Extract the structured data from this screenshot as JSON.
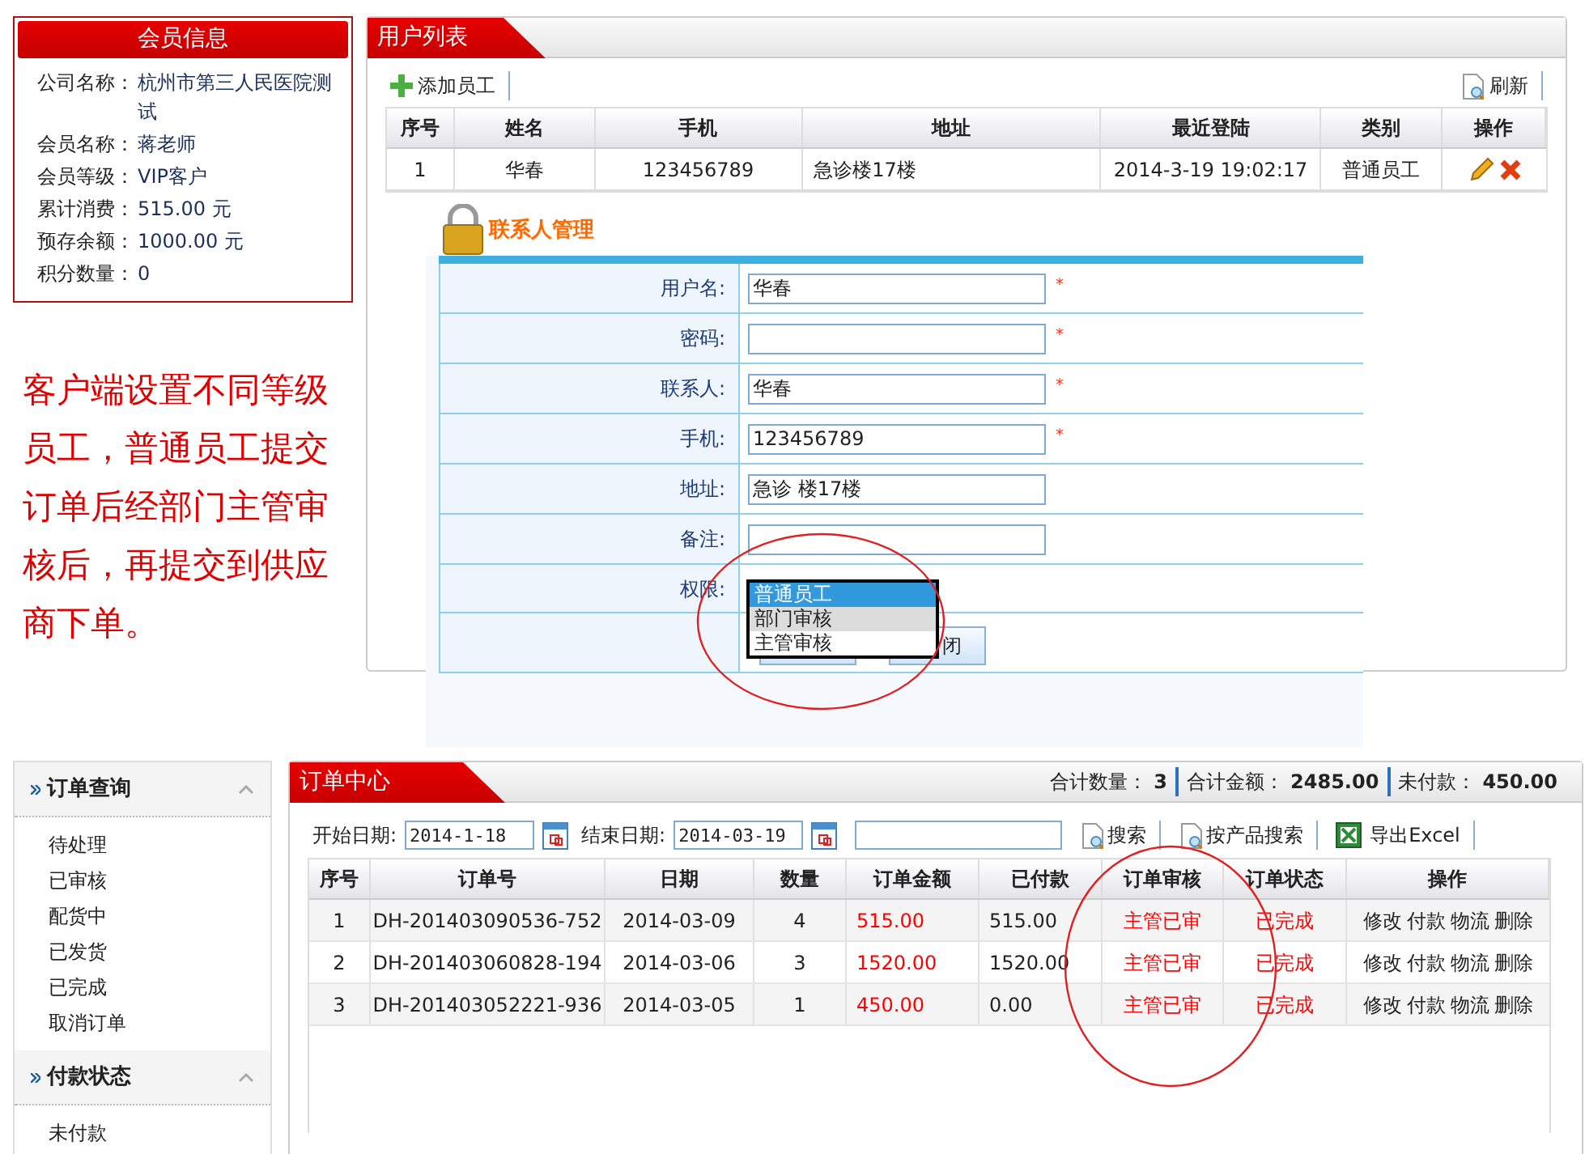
{
  "member_info": {
    "title": "会员信息",
    "fields": [
      {
        "label": "公司名称：",
        "value": "杭州市第三人民医院测试"
      },
      {
        "label": "会员名称：",
        "value": "蒋老师"
      },
      {
        "label": "会员等级：",
        "value": "VIP客户"
      },
      {
        "label": "累计消费：",
        "value": "515.00 元"
      },
      {
        "label": "预存余额：",
        "value": "1000.00 元"
      },
      {
        "label": "积分数量：",
        "value": "0"
      }
    ]
  },
  "note": "客户端设置不同等级员工，普通员工提交订单后经部门主管审核后，再提交到供应商下单。",
  "user_list": {
    "title": "用户列表",
    "add_button": "添加员工",
    "refresh_button": "刷新",
    "columns": [
      "序号",
      "姓名",
      "手机",
      "地址",
      "最近登陆",
      "类别",
      "操作"
    ],
    "rows": [
      {
        "cells": [
          "1",
          "华春",
          "123456789",
          "急诊楼17楼",
          "2014-3-19 19:02:17",
          "普通员工"
        ]
      }
    ]
  },
  "contact_dialog": {
    "title": "联系人管理",
    "fields": [
      {
        "label": "用户名:",
        "value": "华春",
        "mark": "*"
      },
      {
        "label": "密码:",
        "mark": "*"
      },
      {
        "label": "联系人:",
        "value": "华春",
        "mark": "*"
      },
      {
        "label": "手机:",
        "value": "123456789",
        "mark": "*"
      },
      {
        "label": "地址:",
        "value": "急诊 楼17楼"
      },
      {
        "label": "备注:"
      }
    ],
    "permission": {
      "label": "权限:",
      "options": [
        {
          "label": "普通员工",
          "selected": true,
          "hovered": false
        },
        {
          "label": "部门审核",
          "selected": false,
          "hovered": true
        },
        {
          "label": "主管审核",
          "selected": false,
          "hovered": false
        }
      ]
    },
    "buttons": [
      {
        "kind": "covered"
      },
      {
        "kind": "partly_covered",
        "label": "闭"
      }
    ]
  },
  "sidebar": {
    "sections": [
      {
        "title": "订单查询",
        "expanded": true,
        "items": [
          "待处理",
          "已审核",
          "配货中",
          "已发货",
          "已完成",
          "取消订单"
        ]
      },
      {
        "title": "付款状态",
        "expanded": true,
        "items": [
          "未付款"
        ]
      }
    ]
  },
  "order_center": {
    "title": "订单中心",
    "summary": [
      {
        "label": "合计数量：",
        "value": "3"
      },
      {
        "label": "合计金额：",
        "value": "2485.00"
      },
      {
        "label": "未付款：",
        "value": "450.00"
      }
    ],
    "start_label": "开始日期:",
    "start_value": "2014-1-18",
    "end_label": "结束日期:",
    "end_value": "2014-03-19",
    "actions": [
      {
        "kind": "search",
        "label": "搜索"
      },
      {
        "kind": "search",
        "label": "按产品搜索"
      },
      {
        "kind": "excel",
        "label": "导出Excel"
      }
    ],
    "columns": [
      {
        "label": "序号",
        "kind": "plain"
      },
      {
        "label": "订单号",
        "kind": "plain"
      },
      {
        "label": "日期",
        "kind": "plain"
      },
      {
        "label": "数量",
        "kind": "plain"
      },
      {
        "label": "订单金额",
        "kind": "amount"
      },
      {
        "label": "已付款",
        "kind": "plain"
      },
      {
        "label": "订单审核",
        "kind": "status"
      },
      {
        "label": "订单状态",
        "kind": "status"
      },
      {
        "label": "操作",
        "kind": "actions"
      }
    ],
    "rows": [
      {
        "cells": [
          "1",
          "DH-201403090536-752",
          "2014-03-09",
          "4",
          "515.00",
          "515.00",
          "主管已审",
          "已完成"
        ],
        "links": [
          "修改",
          "付款",
          "物流",
          "删除"
        ]
      },
      {
        "cells": [
          "2",
          "DH-201403060828-194",
          "2014-03-06",
          "3",
          "1520.00",
          "1520.00",
          "主管已审",
          "已完成"
        ],
        "links": [
          "修改",
          "付款",
          "物流",
          "删除"
        ]
      },
      {
        "cells": [
          "3",
          "DH-201403052221-936",
          "2014-03-05",
          "1",
          "450.00",
          "0.00",
          "主管已审",
          "已完成"
        ],
        "links": [
          "修改",
          "付款",
          "物流",
          "删除"
        ]
      }
    ]
  }
}
